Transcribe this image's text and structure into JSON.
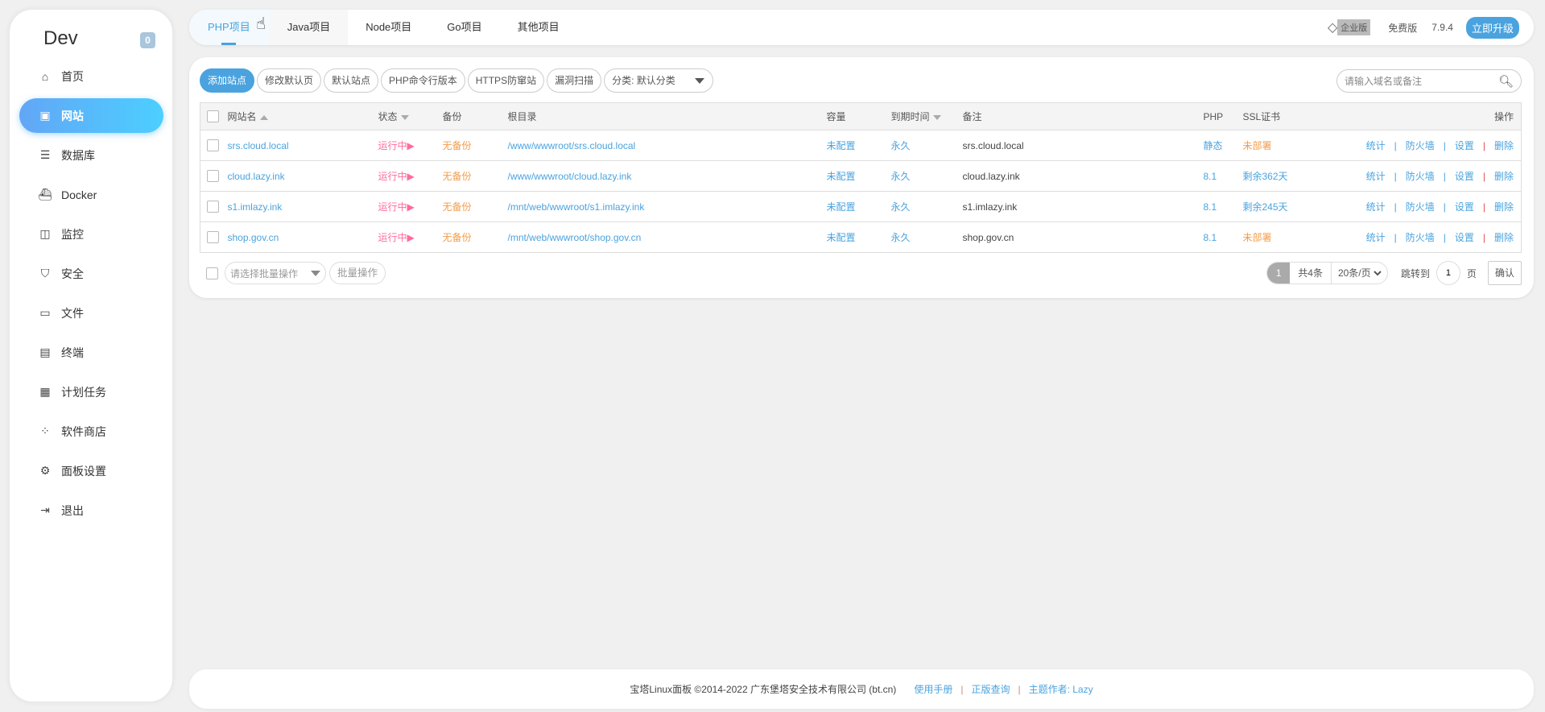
{
  "sidebar": {
    "brand": "Dev",
    "badge": "0",
    "items": [
      {
        "label": "首页",
        "icon": "home-icon"
      },
      {
        "label": "网站",
        "icon": "website-icon"
      },
      {
        "label": "数据库",
        "icon": "database-icon"
      },
      {
        "label": "Docker",
        "icon": "docker-icon"
      },
      {
        "label": "监控",
        "icon": "monitor-icon"
      },
      {
        "label": "安全",
        "icon": "shield-icon"
      },
      {
        "label": "文件",
        "icon": "folder-icon"
      },
      {
        "label": "终端",
        "icon": "terminal-icon"
      },
      {
        "label": "计划任务",
        "icon": "calendar-icon"
      },
      {
        "label": "软件商店",
        "icon": "apps-icon"
      },
      {
        "label": "面板设置",
        "icon": "gear-icon"
      },
      {
        "label": "退出",
        "icon": "logout-icon"
      }
    ]
  },
  "header": {
    "tabs": [
      "PHP项目",
      "Java项目",
      "Node项目",
      "Go项目",
      "其他项目"
    ],
    "enterprise": "企业版",
    "free": "免费版",
    "version": "7.9.4",
    "upgrade": "立即升级"
  },
  "toolbar": {
    "add": "添加站点",
    "edit_default": "修改默认页",
    "default_site": "默认站点",
    "php_cli": "PHP命令行版本",
    "https": "HTTPS防窜站",
    "scan": "漏洞扫描",
    "category": "分类: 默认分类",
    "search_placeholder": "请输入域名或备注"
  },
  "table": {
    "headers": {
      "name": "网站名",
      "status": "状态",
      "backup": "备份",
      "root": "根目录",
      "quota": "容量",
      "expire": "到期时间",
      "remark": "备注",
      "php": "PHP",
      "ssl": "SSL证书",
      "ops": "操作"
    },
    "rows": [
      {
        "name": "srs.cloud.local",
        "status": "运行中",
        "backup": "无备份",
        "root": "/www/wwwroot/srs.cloud.local",
        "quota": "未配置",
        "expire": "永久",
        "remark": "srs.cloud.local",
        "php": "静态",
        "ssl": "未部署",
        "ssl_ok": false
      },
      {
        "name": "cloud.lazy.ink",
        "status": "运行中",
        "backup": "无备份",
        "root": "/www/wwwroot/cloud.lazy.ink",
        "quota": "未配置",
        "expire": "永久",
        "remark": "cloud.lazy.ink",
        "php": "8.1",
        "ssl": "剩余362天",
        "ssl_ok": true
      },
      {
        "name": "s1.imlazy.ink",
        "status": "运行中",
        "backup": "无备份",
        "root": "/mnt/web/wwwroot/s1.imlazy.ink",
        "quota": "未配置",
        "expire": "永久",
        "remark": "s1.imlazy.ink",
        "php": "8.1",
        "ssl": "剩余245天",
        "ssl_ok": true
      },
      {
        "name": "shop.gov.cn",
        "status": "运行中",
        "backup": "无备份",
        "root": "/mnt/web/wwwroot/shop.gov.cn",
        "quota": "未配置",
        "expire": "永久",
        "remark": "shop.gov.cn",
        "php": "8.1",
        "ssl": "未部署",
        "ssl_ok": false
      }
    ],
    "actions": [
      "统计",
      "防火墙",
      "设置",
      "删除"
    ]
  },
  "batch": {
    "placeholder": "请选择批量操作",
    "button": "批量操作"
  },
  "pager": {
    "current": "1",
    "total": "共4条",
    "per_page": "20条/页",
    "jump": "跳转到",
    "page_input": "1",
    "page_unit": "页",
    "confirm": "确认"
  },
  "footer": {
    "copyright": "宝塔Linux面板 ©2014-2022 广东堡塔安全技术有限公司 (bt.cn)",
    "manual": "使用手册",
    "verify": "正版查询",
    "author": "主题作者: Lazy"
  }
}
